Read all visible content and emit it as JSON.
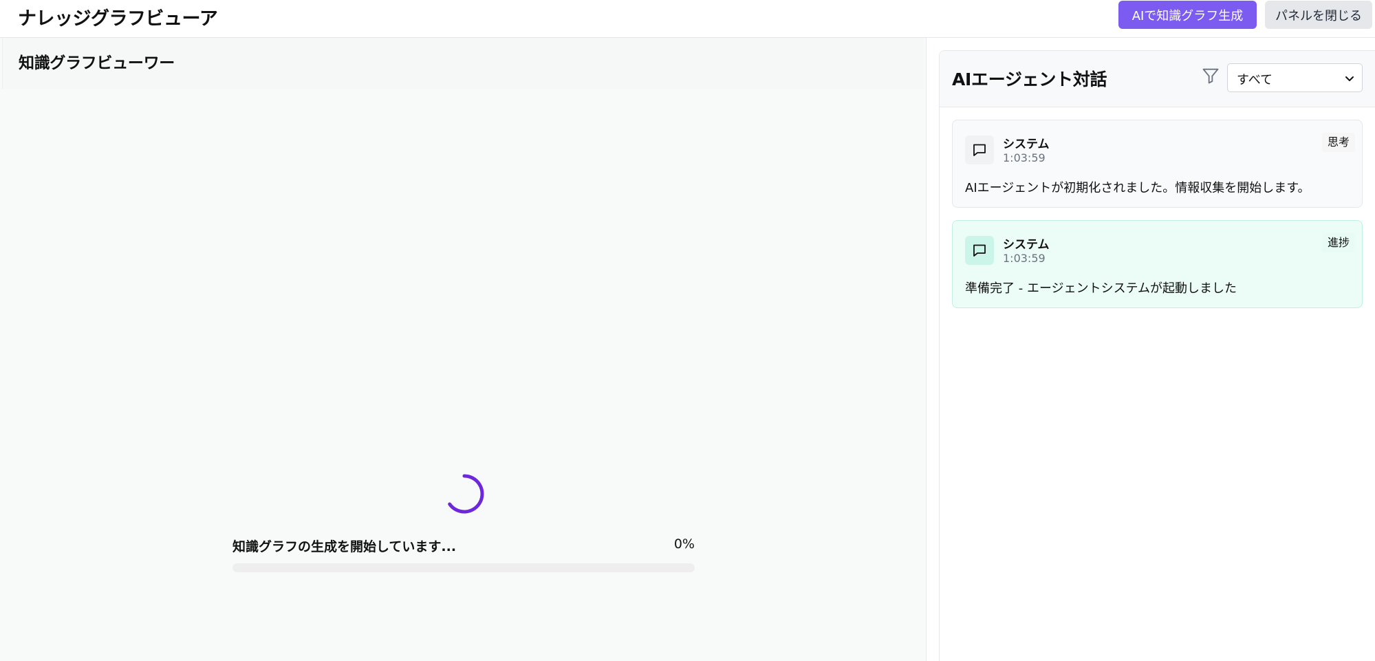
{
  "header": {
    "app_title": "ナレッジグラフビューア",
    "generate_button": "AIで知識グラフ生成",
    "close_panel_button": "パネルを閉じる"
  },
  "viewer": {
    "title": "知識グラフビューワー",
    "progress_label": "知識グラフの生成を開始しています...",
    "progress_percent": "0%",
    "progress_value": 0
  },
  "panel": {
    "title": "AIエージェント対話",
    "filter": {
      "selected": "すべて"
    },
    "messages": [
      {
        "sender": "システム",
        "time": "1:03:59",
        "tag": "思考",
        "text": "AIエージェントが初期化されました。情報収集を開始します。"
      },
      {
        "sender": "システム",
        "time": "1:03:59",
        "tag": "進捗",
        "text": "準備完了 - エージェントシステムが起動しました"
      }
    ]
  },
  "colors": {
    "accent": "#7c5cf0",
    "spinner": "#6d28d9",
    "progress_card_bg": "#ecfdf8"
  }
}
